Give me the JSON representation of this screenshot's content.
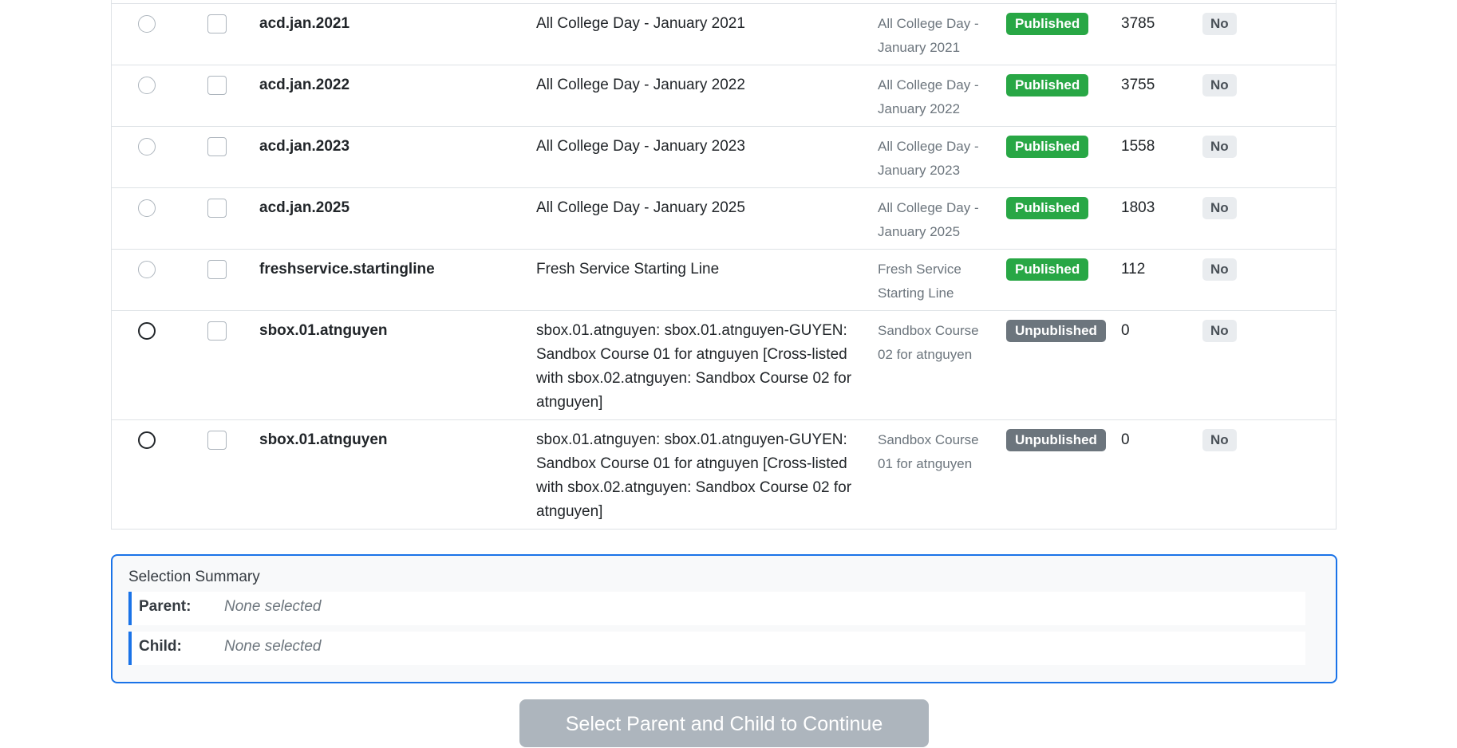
{
  "rows": [
    {
      "code": "acd.jan.2021",
      "name": "All College Day - January 2021",
      "sis": "All College Day - January 2021",
      "status": "Published",
      "count": "3785",
      "flag": "No"
    },
    {
      "code": "acd.jan.2022",
      "name": "All College Day - January 2022",
      "sis": "All College Day - January 2022",
      "status": "Published",
      "count": "3755",
      "flag": "No"
    },
    {
      "code": "acd.jan.2023",
      "name": "All College Day - January 2023",
      "sis": "All College Day - January 2023",
      "status": "Published",
      "count": "1558",
      "flag": "No"
    },
    {
      "code": "acd.jan.2025",
      "name": "All College Day - January 2025",
      "sis": "All College Day - January 2025",
      "status": "Published",
      "count": "1803",
      "flag": "No"
    },
    {
      "code": "freshservice.startingline",
      "name": "Fresh Service Starting Line",
      "sis": "Fresh Service Starting Line",
      "status": "Published",
      "count": "112",
      "flag": "No"
    },
    {
      "code": "sbox.01.atnguyen",
      "name": "sbox.01.atnguyen: sbox.01.atnguyen-GUYEN: Sandbox Course 01 for atnguyen [Cross-listed with sbox.02.atnguyen: Sandbox Course 02 for atnguyen]",
      "sis": "Sandbox Course 02 for atnguyen",
      "status": "Unpublished",
      "count": "0",
      "flag": "No"
    },
    {
      "code": "sbox.01.atnguyen",
      "name": "sbox.01.atnguyen: sbox.01.atnguyen-GUYEN: Sandbox Course 01 for atnguyen [Cross-listed with sbox.02.atnguyen: Sandbox Course 02 for atnguyen]",
      "sis": "Sandbox Course 01 for atnguyen",
      "status": "Unpublished",
      "count": "0",
      "flag": "No"
    }
  ],
  "summary": {
    "title": "Selection Summary",
    "parent_label": "Parent:",
    "parent_value": "None selected",
    "child_label": "Child:",
    "child_value": "None selected"
  },
  "continue_button": "Select Parent and Child to Continue",
  "colors": {
    "accent": "#1a73e8",
    "published": "#28a745",
    "unpublished": "#6c757d"
  }
}
